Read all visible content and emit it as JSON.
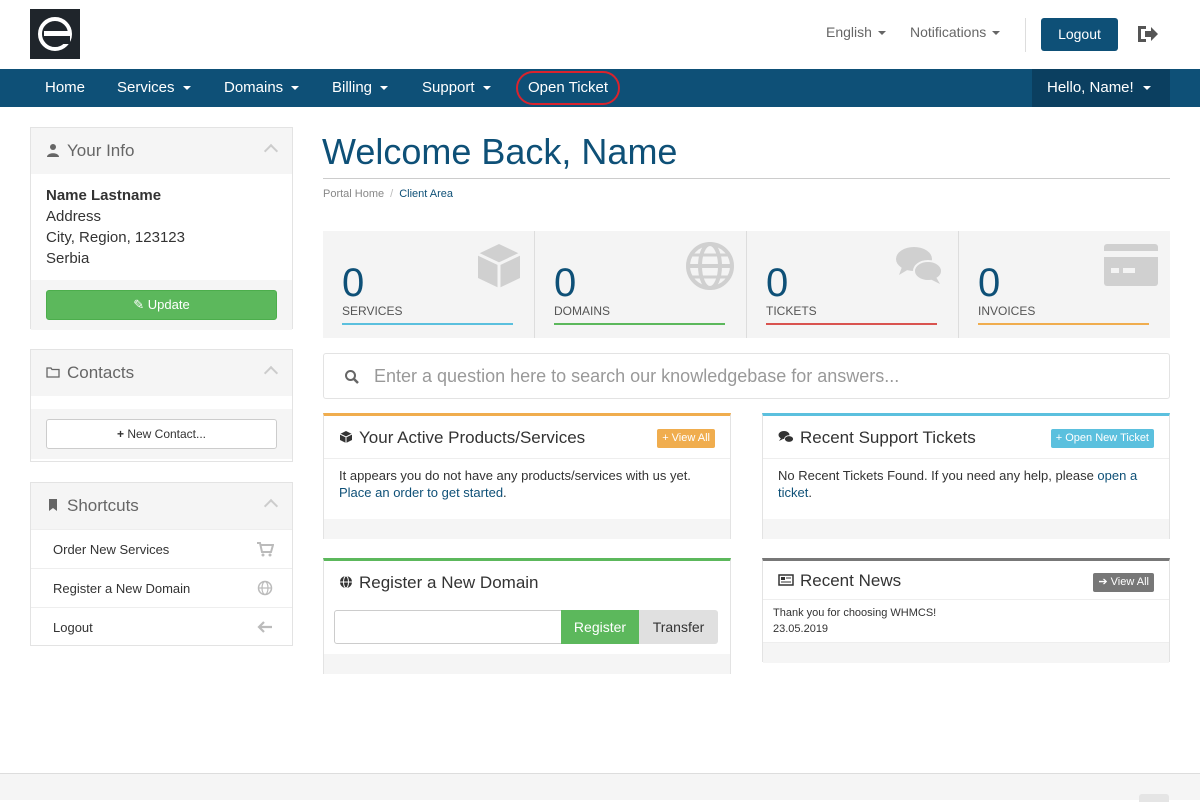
{
  "header": {
    "language": "English",
    "notifications": "Notifications",
    "logout": "Logout"
  },
  "nav": {
    "items": [
      {
        "label": "Home"
      },
      {
        "label": "Services"
      },
      {
        "label": "Domains"
      },
      {
        "label": "Billing"
      },
      {
        "label": "Support"
      },
      {
        "label": "Open Ticket"
      }
    ],
    "user_menu": "Hello, Name!"
  },
  "your_info": {
    "title": "Your Info",
    "name": "Name Lastname",
    "address": "Address",
    "city": "City, Region, 123123",
    "country": "Serbia",
    "update_button": "Update"
  },
  "contacts": {
    "title": "Contacts",
    "new_contact_button": "New Contact..."
  },
  "shortcuts": {
    "title": "Shortcuts",
    "items": [
      {
        "label": "Order New Services",
        "icon": "cart-icon"
      },
      {
        "label": "Register a New Domain",
        "icon": "globe-icon"
      },
      {
        "label": "Logout",
        "icon": "arrow-left-icon"
      }
    ]
  },
  "page": {
    "title": "Welcome Back, Name",
    "breadcrumb": [
      "Portal Home",
      "Client Area"
    ]
  },
  "stats": [
    {
      "value": "0",
      "label": "SERVICES",
      "color": "#5bc0de",
      "icon": "cube-icon"
    },
    {
      "value": "0",
      "label": "DOMAINS",
      "color": "#5cb85c",
      "icon": "globe-icon"
    },
    {
      "value": "0",
      "label": "TICKETS",
      "color": "#d9534f",
      "icon": "comments-icon"
    },
    {
      "value": "0",
      "label": "INVOICES",
      "color": "#f0ad4e",
      "icon": "credit-card-icon"
    }
  ],
  "search": {
    "placeholder": "Enter a question here to search our knowledgebase for answers..."
  },
  "products_card": {
    "title": "Your Active Products/Services",
    "button": "View All",
    "text": "It appears you do not have any products/services with us yet.",
    "link": "Place an order to get started",
    "link_suffix": ".",
    "accent": "#f0ad4e"
  },
  "tickets_card": {
    "title": "Recent Support Tickets",
    "button": "Open New Ticket",
    "text": "No Recent Tickets Found. If you need any help, please ",
    "link": "open a ticket",
    "link_suffix": ".",
    "accent": "#5bc0de"
  },
  "domain_card": {
    "title": "Register a New Domain",
    "register": "Register",
    "transfer": "Transfer",
    "accent": "#5cb85c"
  },
  "news_card": {
    "title": "Recent News",
    "button": "View All",
    "item_text": "Thank you for choosing WHMCS!",
    "item_date": "23.05.2019",
    "accent": "#777777"
  },
  "colors": {
    "brand": "#0e5077",
    "highlight": "#d9232d"
  }
}
